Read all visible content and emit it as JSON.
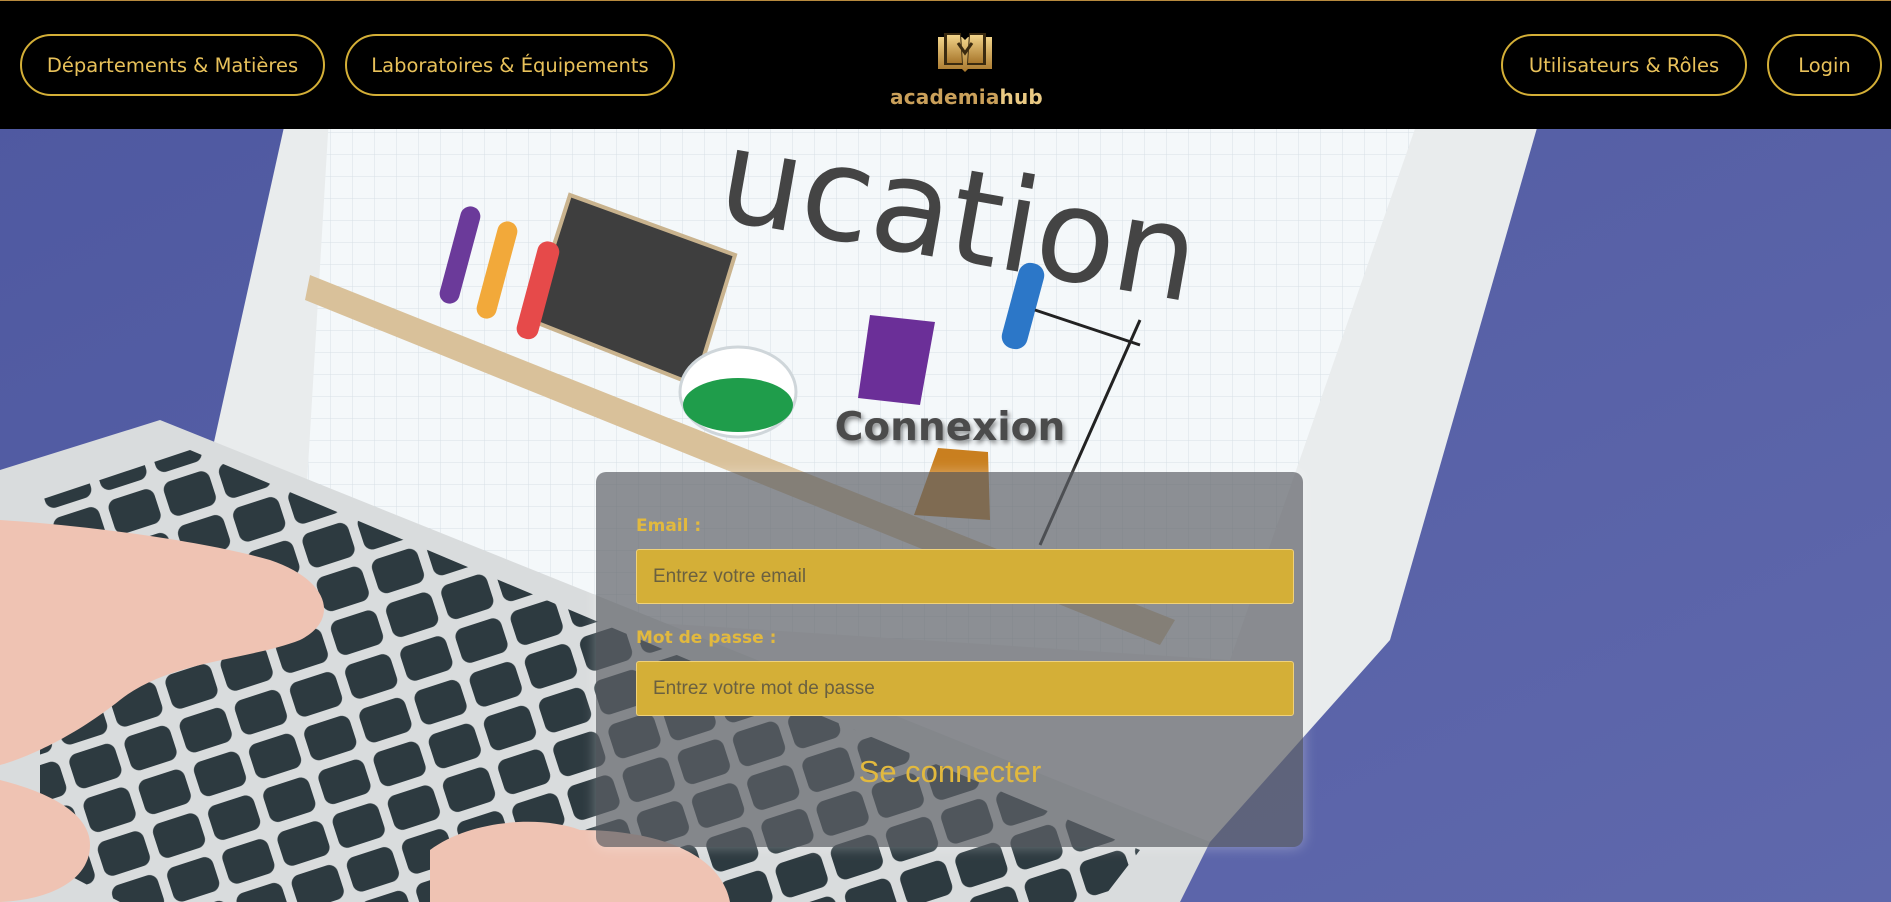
{
  "header": {
    "nav_left": [
      "Départements & Matières",
      "Laboratoires & Équipements"
    ],
    "nav_right": [
      "Utilisateurs & Rôles",
      "Login"
    ],
    "logo": {
      "text_a": "academia",
      "text_b": "hub",
      "icon": "open-book-icon"
    }
  },
  "background": {
    "screen_word": "ucation"
  },
  "login": {
    "title": "Connexion",
    "email_label": "Email :",
    "email_placeholder": "Entrez votre email",
    "password_label": "Mot de passe :",
    "password_placeholder": "Entrez votre mot de passe",
    "submit_label": "Se connecter"
  },
  "colors": {
    "gold": "#d4af37",
    "header_bg": "#000000",
    "backdrop": "#5a63a5"
  }
}
